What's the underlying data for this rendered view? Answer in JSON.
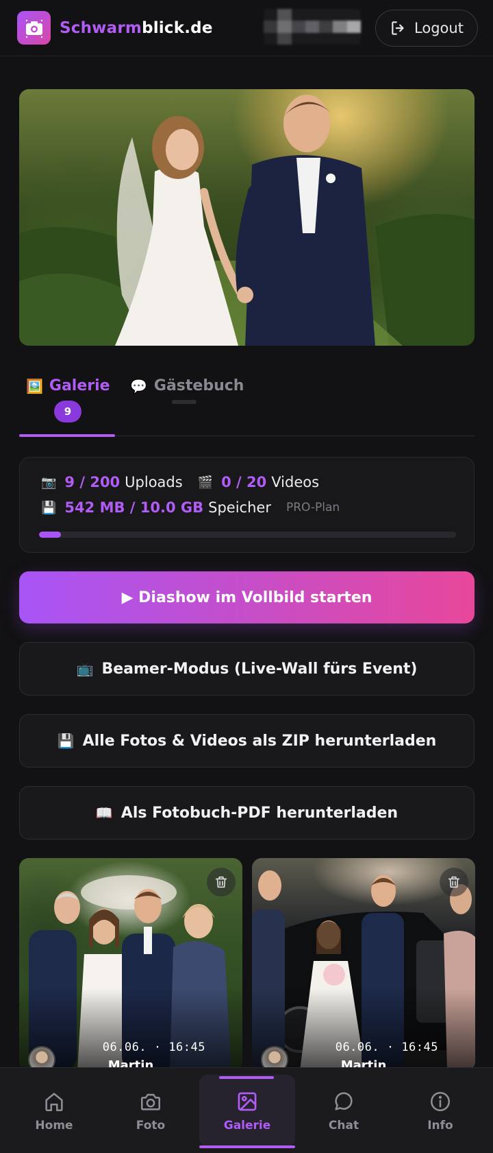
{
  "header": {
    "brand_part1": "Schwarm",
    "brand_part2": "blick.de",
    "logout_label": "Logout",
    "accent": "#b05cf5"
  },
  "hero": {
    "image": "wedding couple holding hands in garden at sunset"
  },
  "tabs": [
    {
      "icon": "🖼️",
      "label": "Galerie",
      "badge": "9",
      "active": true
    },
    {
      "icon": "💬",
      "label": "Gästebuch",
      "active": false
    }
  ],
  "stats": {
    "uploads_icon": "📷",
    "uploads_value": "9 / 200",
    "uploads_label": "Uploads",
    "videos_icon": "🎬",
    "videos_value": "0 / 20",
    "videos_label": "Videos",
    "storage_icon": "💾",
    "storage_value": "542 MB / 10.0 GB",
    "storage_label": "Speicher",
    "plan": "PRO-Plan",
    "storage_progress": 0.053
  },
  "actions": {
    "slideshow": "▶ Diashow im Vollbild starten",
    "beamer_icon": "📺",
    "beamer": "Beamer-Modus (Live-Wall fürs Event)",
    "zip_icon": "💾",
    "zip": "Alle Fotos & Videos als ZIP herunterladen",
    "book_icon": "📖",
    "book": "Als Fotobuch-PDF herunterladen"
  },
  "photos": [
    {
      "date": "06.06. · 16:45",
      "author": "Martin"
    },
    {
      "date": "06.06. · 16:45",
      "author": "Martin"
    }
  ],
  "nav": [
    {
      "label": "Home",
      "icon": "home-icon"
    },
    {
      "label": "Foto",
      "icon": "camera-icon"
    },
    {
      "label": "Galerie",
      "icon": "image-icon",
      "active": true
    },
    {
      "label": "Chat",
      "icon": "chat-icon"
    },
    {
      "label": "Info",
      "icon": "info-icon"
    }
  ]
}
